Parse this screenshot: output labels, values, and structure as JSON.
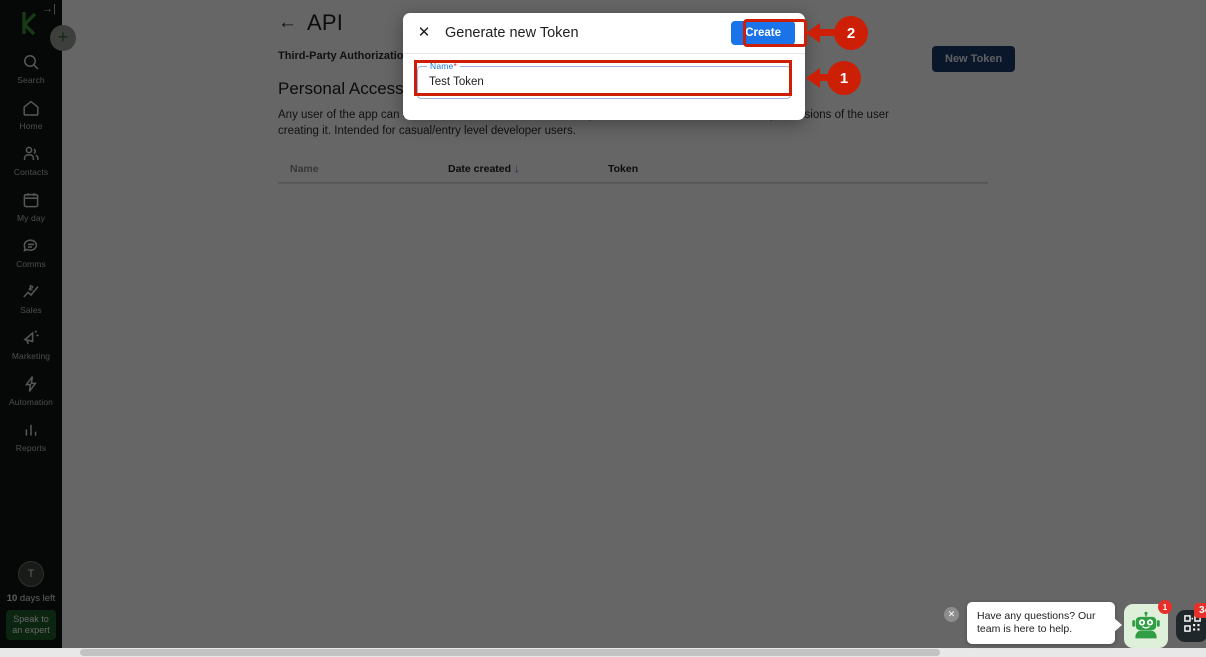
{
  "sidebar": {
    "logo": "k-logo-icon",
    "collapse": "→|",
    "add_button": "+",
    "items": [
      {
        "label": "Search",
        "icon": "search-icon"
      },
      {
        "label": "Home",
        "icon": "home-icon"
      },
      {
        "label": "Contacts",
        "icon": "contacts-icon"
      },
      {
        "label": "My day",
        "icon": "calendar-icon"
      },
      {
        "label": "Comms",
        "icon": "chat-bubble-icon"
      },
      {
        "label": "Sales",
        "icon": "sales-chart-icon"
      },
      {
        "label": "Marketing",
        "icon": "megaphone-icon"
      },
      {
        "label": "Automation",
        "icon": "lightning-bolt-icon"
      },
      {
        "label": "Reports",
        "icon": "bar-chart-icon"
      }
    ],
    "avatar_initial": "T",
    "trial_days_value": "10",
    "trial_days_suffix": " days left",
    "cta_label": "Speak to an expert"
  },
  "main": {
    "back_arrow": "←",
    "title": "API",
    "tabs": [
      {
        "label": "Third-Party Authorizations"
      }
    ],
    "new_token_label": "New Token",
    "section_title": "Personal Access Tokens",
    "section_description": "Any user of the app can create a Personal Access Token. It operates under the user context and permissions of the user creating it. Intended for casual/entry level developer users.",
    "table": {
      "columns": [
        "Name",
        "Date created",
        "Token"
      ],
      "sort_column": "Date created",
      "sort_arrow": "↓",
      "rows": []
    }
  },
  "modal": {
    "close_icon": "✕",
    "title": "Generate new Token",
    "create_label": "Create",
    "field": {
      "label": "Name",
      "required_mark": "*",
      "value": "Test Token",
      "placeholder": ""
    }
  },
  "annotations": [
    {
      "number": "1",
      "target": "name-input"
    },
    {
      "number": "2",
      "target": "create-button"
    }
  ],
  "chat": {
    "dismiss_icon": "✕",
    "message": "Have any questions? Our team is here to help.",
    "bot_badge": "1",
    "qr_badge": "34"
  },
  "colors": {
    "accent_blue": "#1a73e8",
    "annotation_red": "#cc1f06",
    "sidebar_bg": "#0e1511",
    "new_token_blue": "#1b3a6b",
    "cta_green": "#1d5e28",
    "chat_badge_red": "#e8302a"
  }
}
